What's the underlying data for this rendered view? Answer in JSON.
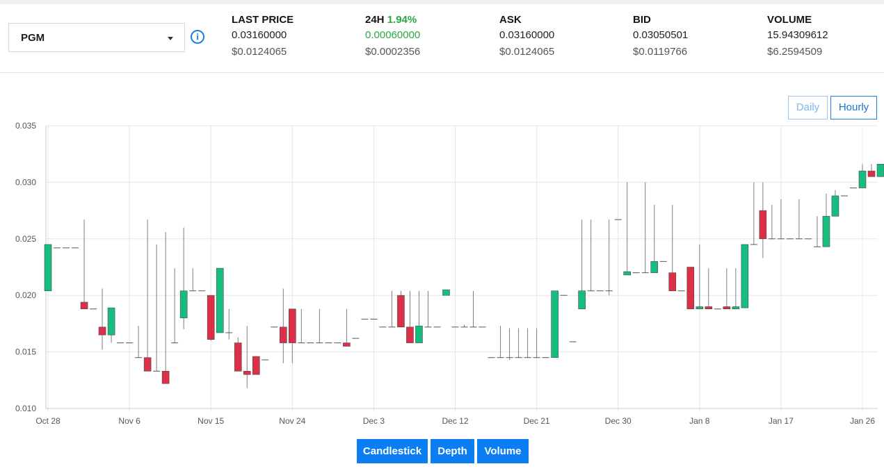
{
  "pair": {
    "symbol": "PGM"
  },
  "stats": {
    "last_price": {
      "title": "LAST PRICE",
      "value": "0.03160000",
      "usd": "$0.0124065"
    },
    "change_24h": {
      "title": "24H",
      "pct": "1.94%",
      "value": "0.00060000",
      "usd": "$0.0002356"
    },
    "ask": {
      "title": "ASK",
      "value": "0.03160000",
      "usd": "$0.0124065"
    },
    "bid": {
      "title": "BID",
      "value": "0.03050501",
      "usd": "$0.0119766"
    },
    "volume": {
      "title": "VOLUME",
      "value": "15.94309612",
      "usd": "$6.2594509"
    }
  },
  "range_toggle": {
    "daily": "Daily",
    "hourly": "Hourly"
  },
  "tabs": {
    "candlestick": "Candlestick",
    "depth": "Depth",
    "volume": "Volume"
  },
  "colors": {
    "up": "#17bd7e",
    "down": "#dc2f48",
    "accent": "#0a7ef2",
    "positive": "#29a843"
  },
  "icons": {
    "info": "info-circle-icon",
    "dropdown": "caret-down-icon"
  },
  "chart_data": {
    "type": "candlestick",
    "ylim": [
      0.01,
      0.035
    ],
    "yticks": [
      "0.010",
      "0.015",
      "0.020",
      "0.025",
      "0.030",
      "0.035"
    ],
    "xticks": [
      "Oct 28",
      "Nov 6",
      "Nov 15",
      "Nov 24",
      "Dec 3",
      "Dec 12",
      "Dec 21",
      "Dec 30",
      "Jan 8",
      "Jan 17",
      "Jan 26"
    ],
    "candles": [
      {
        "o": 0.0204,
        "h": 0.0245,
        "l": 0.0204,
        "c": 0.0245
      },
      {
        "o": 0.0242,
        "h": 0.0242,
        "l": 0.0242,
        "c": 0.0242
      },
      {
        "o": 0.0242,
        "h": 0.0242,
        "l": 0.0242,
        "c": 0.0242
      },
      {
        "o": 0.0242,
        "h": 0.0242,
        "l": 0.0242,
        "c": 0.0242
      },
      {
        "o": 0.0194,
        "h": 0.0267,
        "l": 0.0188,
        "c": 0.0188
      },
      {
        "o": 0.0188,
        "h": 0.0188,
        "l": 0.0188,
        "c": 0.0188
      },
      {
        "o": 0.0172,
        "h": 0.0206,
        "l": 0.0152,
        "c": 0.0165
      },
      {
        "o": 0.0165,
        "h": 0.0175,
        "l": 0.0158,
        "c": 0.0189
      },
      {
        "o": 0.0158,
        "h": 0.0158,
        "l": 0.0158,
        "c": 0.0158
      },
      {
        "o": 0.0158,
        "h": 0.0158,
        "l": 0.0158,
        "c": 0.0158
      },
      {
        "o": 0.0145,
        "h": 0.0173,
        "l": 0.0145,
        "c": 0.0145
      },
      {
        "o": 0.0145,
        "h": 0.0267,
        "l": 0.0133,
        "c": 0.0133
      },
      {
        "o": 0.0133,
        "h": 0.0245,
        "l": 0.0133,
        "c": 0.0133
      },
      {
        "o": 0.0133,
        "h": 0.0256,
        "l": 0.0122,
        "c": 0.0122
      },
      {
        "o": 0.0158,
        "h": 0.0224,
        "l": 0.0158,
        "c": 0.0158
      },
      {
        "o": 0.018,
        "h": 0.026,
        "l": 0.017,
        "c": 0.0204
      },
      {
        "o": 0.0204,
        "h": 0.0224,
        "l": 0.0204,
        "c": 0.0204
      },
      {
        "o": 0.0204,
        "h": 0.0204,
        "l": 0.0204,
        "c": 0.0204
      },
      {
        "o": 0.02,
        "h": 0.02,
        "l": 0.016,
        "c": 0.0161
      },
      {
        "o": 0.0167,
        "h": 0.0224,
        "l": 0.0167,
        "c": 0.0224
      },
      {
        "o": 0.0167,
        "h": 0.0188,
        "l": 0.0161,
        "c": 0.0167
      },
      {
        "o": 0.0158,
        "h": 0.0163,
        "l": 0.0133,
        "c": 0.0133
      },
      {
        "o": 0.0133,
        "h": 0.0173,
        "l": 0.0118,
        "c": 0.013
      },
      {
        "o": 0.0146,
        "h": 0.0146,
        "l": 0.013,
        "c": 0.013
      },
      {
        "o": 0.0143,
        "h": 0.0143,
        "l": 0.0143,
        "c": 0.0143
      },
      {
        "o": 0.0172,
        "h": 0.0172,
        "l": 0.0172,
        "c": 0.0172
      },
      {
        "o": 0.0172,
        "h": 0.0206,
        "l": 0.014,
        "c": 0.0158
      },
      {
        "o": 0.0188,
        "h": 0.0188,
        "l": 0.014,
        "c": 0.0158
      },
      {
        "o": 0.0158,
        "h": 0.0188,
        "l": 0.0158,
        "c": 0.0158
      },
      {
        "o": 0.0158,
        "h": 0.0158,
        "l": 0.0158,
        "c": 0.0158
      },
      {
        "o": 0.0158,
        "h": 0.0188,
        "l": 0.0158,
        "c": 0.0158
      },
      {
        "o": 0.0158,
        "h": 0.0158,
        "l": 0.0158,
        "c": 0.0158
      },
      {
        "o": 0.0158,
        "h": 0.0158,
        "l": 0.0158,
        "c": 0.0158
      },
      {
        "o": 0.0158,
        "h": 0.0188,
        "l": 0.0155,
        "c": 0.0155
      },
      {
        "o": 0.0162,
        "h": 0.0162,
        "l": 0.0162,
        "c": 0.0162
      },
      {
        "o": 0.0179,
        "h": 0.0179,
        "l": 0.0179,
        "c": 0.0179
      },
      {
        "o": 0.0179,
        "h": 0.0179,
        "l": 0.0179,
        "c": 0.0179
      },
      {
        "o": 0.0172,
        "h": 0.0172,
        "l": 0.0172,
        "c": 0.0172
      },
      {
        "o": 0.0172,
        "h": 0.0204,
        "l": 0.0172,
        "c": 0.0172
      },
      {
        "o": 0.02,
        "h": 0.0204,
        "l": 0.0172,
        "c": 0.0172
      },
      {
        "o": 0.0172,
        "h": 0.0204,
        "l": 0.0158,
        "c": 0.0158
      },
      {
        "o": 0.0158,
        "h": 0.0204,
        "l": 0.0158,
        "c": 0.0173
      },
      {
        "o": 0.0172,
        "h": 0.0204,
        "l": 0.0172,
        "c": 0.0172
      },
      {
        "o": 0.0172,
        "h": 0.0172,
        "l": 0.0172,
        "c": 0.0172
      },
      {
        "o": 0.02,
        "h": 0.02,
        "l": 0.02,
        "c": 0.0205
      },
      {
        "o": 0.0172,
        "h": 0.0172,
        "l": 0.0172,
        "c": 0.0172
      },
      {
        "o": 0.0172,
        "h": 0.0174,
        "l": 0.0172,
        "c": 0.0172
      },
      {
        "o": 0.0172,
        "h": 0.0204,
        "l": 0.0172,
        "c": 0.0172
      },
      {
        "o": 0.0172,
        "h": 0.0172,
        "l": 0.0172,
        "c": 0.0172
      },
      {
        "o": 0.0145,
        "h": 0.0145,
        "l": 0.0145,
        "c": 0.0145
      },
      {
        "o": 0.0145,
        "h": 0.0173,
        "l": 0.0145,
        "c": 0.0145
      },
      {
        "o": 0.0145,
        "h": 0.0171,
        "l": 0.0143,
        "c": 0.0145
      },
      {
        "o": 0.0145,
        "h": 0.0171,
        "l": 0.0145,
        "c": 0.0145
      },
      {
        "o": 0.0145,
        "h": 0.0171,
        "l": 0.0145,
        "c": 0.0145
      },
      {
        "o": 0.0145,
        "h": 0.0171,
        "l": 0.0145,
        "c": 0.0145
      },
      {
        "o": 0.0145,
        "h": 0.0145,
        "l": 0.0145,
        "c": 0.0145
      },
      {
        "o": 0.0145,
        "h": 0.0204,
        "l": 0.0145,
        "c": 0.0204
      },
      {
        "o": 0.02,
        "h": 0.02,
        "l": 0.02,
        "c": 0.02
      },
      {
        "o": 0.0159,
        "h": 0.0159,
        "l": 0.0159,
        "c": 0.0159
      },
      {
        "o": 0.0188,
        "h": 0.0267,
        "l": 0.0188,
        "c": 0.0204
      },
      {
        "o": 0.0204,
        "h": 0.0267,
        "l": 0.0204,
        "c": 0.0204
      },
      {
        "o": 0.0204,
        "h": 0.0204,
        "l": 0.0204,
        "c": 0.0204
      },
      {
        "o": 0.0204,
        "h": 0.0267,
        "l": 0.02,
        "c": 0.0204
      },
      {
        "o": 0.0267,
        "h": 0.0267,
        "l": 0.0267,
        "c": 0.0267
      },
      {
        "o": 0.0218,
        "h": 0.03,
        "l": 0.0218,
        "c": 0.0221
      },
      {
        "o": 0.022,
        "h": 0.022,
        "l": 0.022,
        "c": 0.022
      },
      {
        "o": 0.022,
        "h": 0.03,
        "l": 0.022,
        "c": 0.022
      },
      {
        "o": 0.022,
        "h": 0.028,
        "l": 0.022,
        "c": 0.023
      },
      {
        "o": 0.023,
        "h": 0.023,
        "l": 0.023,
        "c": 0.023
      },
      {
        "o": 0.022,
        "h": 0.028,
        "l": 0.0204,
        "c": 0.0204
      },
      {
        "o": 0.0204,
        "h": 0.0204,
        "l": 0.0204,
        "c": 0.0204
      },
      {
        "o": 0.0225,
        "h": 0.0225,
        "l": 0.0188,
        "c": 0.0188
      },
      {
        "o": 0.0188,
        "h": 0.0245,
        "l": 0.0188,
        "c": 0.019
      },
      {
        "o": 0.019,
        "h": 0.0224,
        "l": 0.0188,
        "c": 0.0188
      },
      {
        "o": 0.0188,
        "h": 0.0188,
        "l": 0.0188,
        "c": 0.0188
      },
      {
        "o": 0.019,
        "h": 0.0224,
        "l": 0.0188,
        "c": 0.0188
      },
      {
        "o": 0.0188,
        "h": 0.0224,
        "l": 0.0188,
        "c": 0.019
      },
      {
        "o": 0.0189,
        "h": 0.0245,
        "l": 0.0189,
        "c": 0.0245
      },
      {
        "o": 0.0245,
        "h": 0.03,
        "l": 0.0245,
        "c": 0.0245
      },
      {
        "o": 0.0275,
        "h": 0.03,
        "l": 0.0233,
        "c": 0.025
      },
      {
        "o": 0.025,
        "h": 0.028,
        "l": 0.025,
        "c": 0.025
      },
      {
        "o": 0.025,
        "h": 0.0285,
        "l": 0.025,
        "c": 0.025
      },
      {
        "o": 0.025,
        "h": 0.025,
        "l": 0.025,
        "c": 0.025
      },
      {
        "o": 0.025,
        "h": 0.0285,
        "l": 0.025,
        "c": 0.025
      },
      {
        "o": 0.025,
        "h": 0.025,
        "l": 0.025,
        "c": 0.025
      },
      {
        "o": 0.0243,
        "h": 0.027,
        "l": 0.0243,
        "c": 0.0243
      },
      {
        "o": 0.0243,
        "h": 0.029,
        "l": 0.0243,
        "c": 0.027
      },
      {
        "o": 0.027,
        "h": 0.0293,
        "l": 0.027,
        "c": 0.0288
      },
      {
        "o": 0.0288,
        "h": 0.0288,
        "l": 0.0288,
        "c": 0.0288
      },
      {
        "o": 0.0295,
        "h": 0.0295,
        "l": 0.0295,
        "c": 0.0295
      },
      {
        "o": 0.0295,
        "h": 0.0316,
        "l": 0.0295,
        "c": 0.031
      },
      {
        "o": 0.031,
        "h": 0.0316,
        "l": 0.0305,
        "c": 0.0305
      },
      {
        "o": 0.0305,
        "h": 0.0316,
        "l": 0.0305,
        "c": 0.0316
      }
    ]
  }
}
